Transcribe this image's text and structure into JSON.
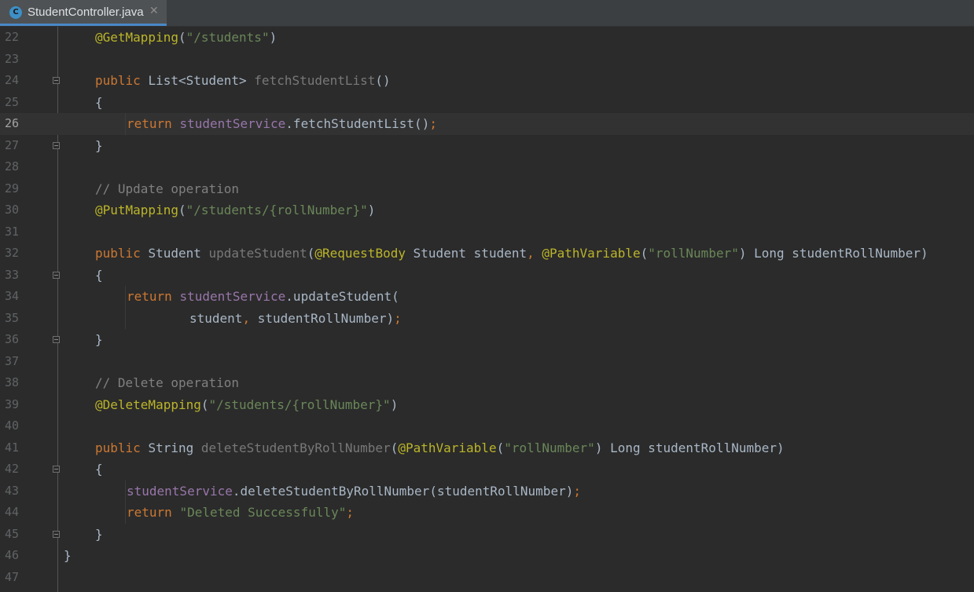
{
  "tab": {
    "icon_letter": "C",
    "filename": "StudentController.java",
    "close_glyph": "✕"
  },
  "colors": {
    "keyword": "#cc7832",
    "annotation": "#bbb529",
    "string": "#6a8759",
    "comment": "#808080",
    "field": "#9876aa",
    "unused_method": "#787878",
    "plain": "#a9b7c6",
    "background": "#2b2b2b"
  },
  "current_line": "26",
  "lines": [
    {
      "n": "22",
      "fold": "",
      "indent": 1,
      "tokens": [
        [
          "ann",
          "@GetMapping"
        ],
        [
          "plain",
          "("
        ],
        [
          "str",
          "\"/students\""
        ],
        [
          "plain",
          ")"
        ]
      ]
    },
    {
      "n": "23",
      "fold": "",
      "indent": 0,
      "tokens": []
    },
    {
      "n": "24",
      "fold": "open",
      "indent": 1,
      "tokens": [
        [
          "kw",
          "public "
        ],
        [
          "plain",
          "List<Student> "
        ],
        [
          "fn-unused",
          "fetchStudentList"
        ],
        [
          "plain",
          "()"
        ]
      ]
    },
    {
      "n": "25",
      "fold": "",
      "indent": 1,
      "tokens": [
        [
          "plain",
          "{"
        ]
      ]
    },
    {
      "n": "26",
      "fold": "",
      "indent": 2,
      "tokens": [
        [
          "kw",
          "return "
        ],
        [
          "fld",
          "studentService"
        ],
        [
          "plain",
          ".fetchStudentList()"
        ],
        [
          "punct",
          ";"
        ]
      ]
    },
    {
      "n": "27",
      "fold": "close",
      "indent": 1,
      "tokens": [
        [
          "plain",
          "}"
        ]
      ]
    },
    {
      "n": "28",
      "fold": "",
      "indent": 0,
      "tokens": []
    },
    {
      "n": "29",
      "fold": "",
      "indent": 1,
      "tokens": [
        [
          "cmt",
          "// Update operation"
        ]
      ]
    },
    {
      "n": "30",
      "fold": "",
      "indent": 1,
      "tokens": [
        [
          "ann",
          "@PutMapping"
        ],
        [
          "plain",
          "("
        ],
        [
          "str",
          "\"/students/{rollNumber}\""
        ],
        [
          "plain",
          ")"
        ]
      ]
    },
    {
      "n": "31",
      "fold": "",
      "indent": 0,
      "tokens": []
    },
    {
      "n": "32",
      "fold": "",
      "indent": 1,
      "tokens": [
        [
          "kw",
          "public "
        ],
        [
          "plain",
          "Student "
        ],
        [
          "fn-unused",
          "updateStudent"
        ],
        [
          "plain",
          "("
        ],
        [
          "ann",
          "@RequestBody "
        ],
        [
          "plain",
          "Student student"
        ],
        [
          "punct",
          ", "
        ],
        [
          "ann",
          "@PathVariable"
        ],
        [
          "plain",
          "("
        ],
        [
          "str",
          "\"rollNumber\""
        ],
        [
          "plain",
          ") Long studentRollNumber)"
        ]
      ]
    },
    {
      "n": "33",
      "fold": "open",
      "indent": 1,
      "tokens": [
        [
          "plain",
          "{"
        ]
      ]
    },
    {
      "n": "34",
      "fold": "",
      "indent": 2,
      "tokens": [
        [
          "kw",
          "return "
        ],
        [
          "fld",
          "studentService"
        ],
        [
          "plain",
          ".updateStudent("
        ]
      ]
    },
    {
      "n": "35",
      "fold": "",
      "indent": 4,
      "tokens": [
        [
          "plain",
          "student"
        ],
        [
          "punct",
          ", "
        ],
        [
          "plain",
          "studentRollNumber)"
        ],
        [
          "punct",
          ";"
        ]
      ]
    },
    {
      "n": "36",
      "fold": "close",
      "indent": 1,
      "tokens": [
        [
          "plain",
          "}"
        ]
      ]
    },
    {
      "n": "37",
      "fold": "",
      "indent": 0,
      "tokens": []
    },
    {
      "n": "38",
      "fold": "",
      "indent": 1,
      "tokens": [
        [
          "cmt",
          "// Delete operation"
        ]
      ]
    },
    {
      "n": "39",
      "fold": "",
      "indent": 1,
      "tokens": [
        [
          "ann",
          "@DeleteMapping"
        ],
        [
          "plain",
          "("
        ],
        [
          "str",
          "\"/students/{rollNumber}\""
        ],
        [
          "plain",
          ")"
        ]
      ]
    },
    {
      "n": "40",
      "fold": "",
      "indent": 0,
      "tokens": []
    },
    {
      "n": "41",
      "fold": "",
      "indent": 1,
      "tokens": [
        [
          "kw",
          "public "
        ],
        [
          "plain",
          "String "
        ],
        [
          "fn-unused",
          "deleteStudentByRollNumber"
        ],
        [
          "plain",
          "("
        ],
        [
          "ann",
          "@PathVariable"
        ],
        [
          "plain",
          "("
        ],
        [
          "str",
          "\"rollNumber\""
        ],
        [
          "plain",
          ") Long studentRollNumber)"
        ]
      ]
    },
    {
      "n": "42",
      "fold": "open",
      "indent": 1,
      "tokens": [
        [
          "plain",
          "{"
        ]
      ]
    },
    {
      "n": "43",
      "fold": "",
      "indent": 2,
      "tokens": [
        [
          "fld",
          "studentService"
        ],
        [
          "plain",
          ".deleteStudentByRollNumber(studentRollNumber)"
        ],
        [
          "punct",
          ";"
        ]
      ]
    },
    {
      "n": "44",
      "fold": "",
      "indent": 2,
      "tokens": [
        [
          "kw",
          "return "
        ],
        [
          "str",
          "\"Deleted Successfully\""
        ],
        [
          "punct",
          ";"
        ]
      ]
    },
    {
      "n": "45",
      "fold": "close",
      "indent": 1,
      "tokens": [
        [
          "plain",
          "}"
        ]
      ]
    },
    {
      "n": "46",
      "fold": "",
      "indent": 0,
      "tokens": [
        [
          "plain",
          "}"
        ]
      ]
    },
    {
      "n": "47",
      "fold": "",
      "indent": 0,
      "tokens": []
    }
  ]
}
